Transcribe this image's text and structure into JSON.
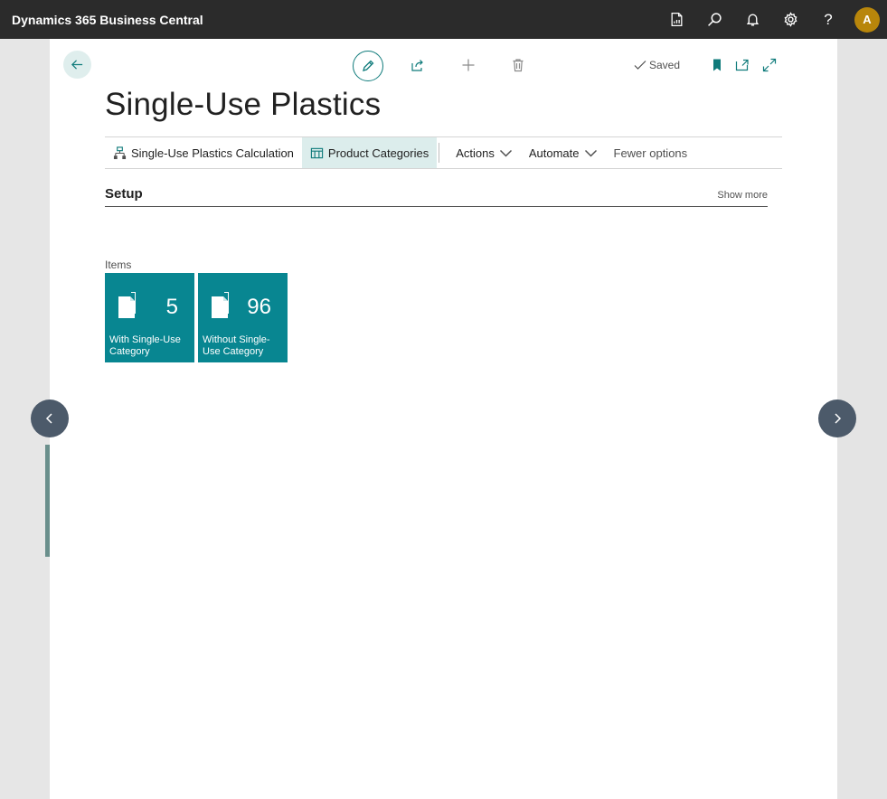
{
  "app": {
    "title": "Dynamics 365 Business Central"
  },
  "topbar": {
    "icons": [
      "report-icon",
      "search-icon",
      "bell-icon",
      "gear-icon",
      "help-icon"
    ],
    "help_glyph": "?",
    "avatar_initial": "A"
  },
  "dialog": {
    "title": "Single-Use Plastics",
    "status": "Saved",
    "toolbar_icons": [
      "edit-icon",
      "share-icon",
      "add-icon",
      "delete-icon",
      "bookmark-icon",
      "open-new-window-icon",
      "expand-icon"
    ],
    "actions": [
      {
        "label": "Single-Use Plastics Calculation",
        "icon": "hierarchy-icon"
      },
      {
        "label": "Product Categories",
        "icon": "table-icon",
        "active": true
      },
      {
        "label": "Actions"
      },
      {
        "label": "Automate"
      },
      {
        "label": "Fewer options"
      }
    ],
    "section": {
      "title": "Setup",
      "show_more": "Show more"
    },
    "group_label": "Items",
    "tiles": [
      {
        "value": "5",
        "label": "With Single-Use Category"
      },
      {
        "value": "96",
        "label": "Without Single-Use Category"
      }
    ]
  },
  "colors": {
    "accent": "#0f7b7b",
    "tile": "#088691",
    "topbar": "#2b2b2b",
    "avatar": "#b8860b"
  }
}
